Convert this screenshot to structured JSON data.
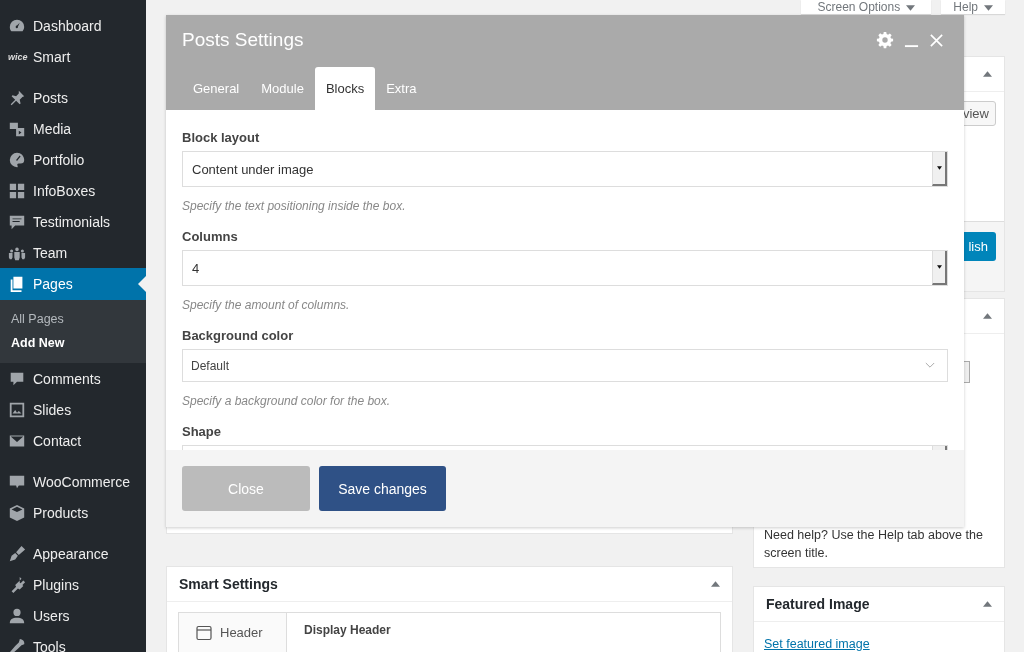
{
  "sidebar": {
    "groups": [
      {
        "items": [
          {
            "label": "Dashboard",
            "selected": false
          },
          {
            "label": "Smart",
            "logo_text": "wice",
            "selected": false
          }
        ]
      },
      {
        "items": [
          {
            "label": "Posts",
            "selected": false
          },
          {
            "label": "Media",
            "selected": false
          },
          {
            "label": "Portfolio",
            "selected": false
          },
          {
            "label": "InfoBoxes",
            "selected": false
          },
          {
            "label": "Testimonials",
            "selected": false
          },
          {
            "label": "Team",
            "selected": false
          },
          {
            "label": "Pages",
            "selected": true,
            "submenu": [
              {
                "label": "All Pages",
                "selected": false
              },
              {
                "label": "Add New",
                "selected": true
              }
            ]
          },
          {
            "label": "Comments",
            "selected": false
          },
          {
            "label": "Slides",
            "selected": false
          },
          {
            "label": "Contact",
            "selected": false
          }
        ]
      },
      {
        "items": [
          {
            "label": "WooCommerce",
            "selected": false
          },
          {
            "label": "Products",
            "selected": false
          }
        ]
      },
      {
        "items": [
          {
            "label": "Appearance",
            "selected": false
          },
          {
            "label": "Plugins",
            "selected": false
          },
          {
            "label": "Users",
            "selected": false
          },
          {
            "label": "Tools",
            "selected": false
          }
        ]
      }
    ]
  },
  "top_buttons": [
    "Screen Options",
    "Help"
  ],
  "smart_settings": {
    "title": "Smart Settings",
    "tab": "Header",
    "heading": "Display Header"
  },
  "publish_box": {
    "preview_button": "view",
    "publish_button": "lish"
  },
  "help_box": {
    "text": "Need help? Use the Help tab above the screen title."
  },
  "featured_image": {
    "title": "Featured Image",
    "link": "Set featured image"
  },
  "modal": {
    "title": "Posts Settings",
    "tabs": [
      {
        "label": "General",
        "selected": false
      },
      {
        "label": "Module",
        "selected": false
      },
      {
        "label": "Blocks",
        "selected": true
      },
      {
        "label": "Extra",
        "selected": false
      }
    ],
    "fields": [
      {
        "label": "Block layout",
        "kind": "legacy-select",
        "value": "Content under image",
        "description": "Specify the text positioning inside the box."
      },
      {
        "label": "Columns",
        "kind": "legacy-select",
        "value": "4",
        "description": "Specify the amount of columns."
      },
      {
        "label": "Background color",
        "kind": "select",
        "value": "Default",
        "description": "Specify a background color for the box."
      },
      {
        "label": "Shape",
        "kind": "legacy-select"
      }
    ],
    "buttons": [
      {
        "label": "Close",
        "kind": "secondary"
      },
      {
        "label": "Save changes",
        "kind": "primary"
      }
    ]
  }
}
